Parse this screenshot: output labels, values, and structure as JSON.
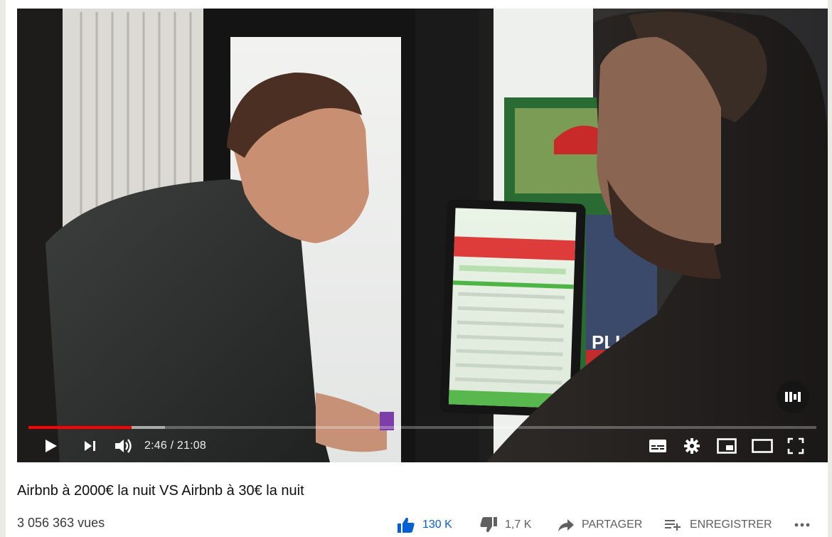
{
  "video": {
    "current_time": "2:46",
    "duration": "21:08",
    "progress_fraction": 0.131,
    "buffered_fraction": 0.173
  },
  "info": {
    "title": "Airbnb à 2000€ la nuit VS Airbnb à 30€ la nuit",
    "views": "3 056 363 vues"
  },
  "actions": {
    "like_count": "130 K",
    "dislike_count": "1,7 K",
    "share_label": "PARTAGER",
    "save_label": "ENREGISTRER"
  },
  "colors": {
    "accent_red": "#ff0000",
    "like_blue": "#065fd4",
    "icon_gray": "#606060"
  },
  "icons": [
    "play-icon",
    "next-icon",
    "volume-icon",
    "subtitles-icon",
    "settings-icon",
    "miniplayer-icon",
    "theater-icon",
    "fullscreen-icon",
    "autoplay-badge-icon",
    "like-icon",
    "dislike-icon",
    "share-icon",
    "save-playlist-icon",
    "more-icon"
  ]
}
